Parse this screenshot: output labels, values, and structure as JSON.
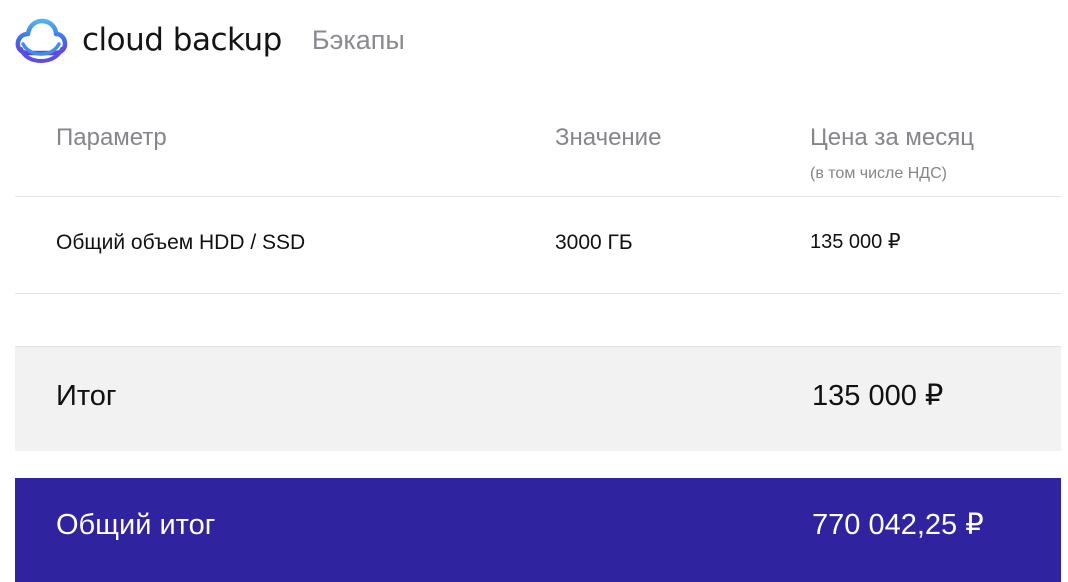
{
  "header": {
    "brand_name": "cloud backup",
    "section_title": "Бэкапы",
    "logo_icon": "cloud-icon",
    "logo_gradient": [
      "#4fb2f2",
      "#3e56e0",
      "#6a3fd6"
    ]
  },
  "table": {
    "columns": {
      "param": "Параметр",
      "value": "Значение",
      "price": "Цена за месяц",
      "price_note": "(в том числе НДС)"
    },
    "rows": [
      {
        "param": "Общий объем HDD / SSD",
        "value": "3000 ГБ",
        "price": "135 000 ₽"
      }
    ]
  },
  "subtotal": {
    "label": "Итог",
    "value": "135 000  ₽"
  },
  "grand_total": {
    "label": "Общий итог",
    "value": "770 042,25 ₽"
  },
  "colors": {
    "accent": "#2f239f",
    "header_text": "#85858b",
    "subtotal_bg": "#f2f2f2"
  }
}
